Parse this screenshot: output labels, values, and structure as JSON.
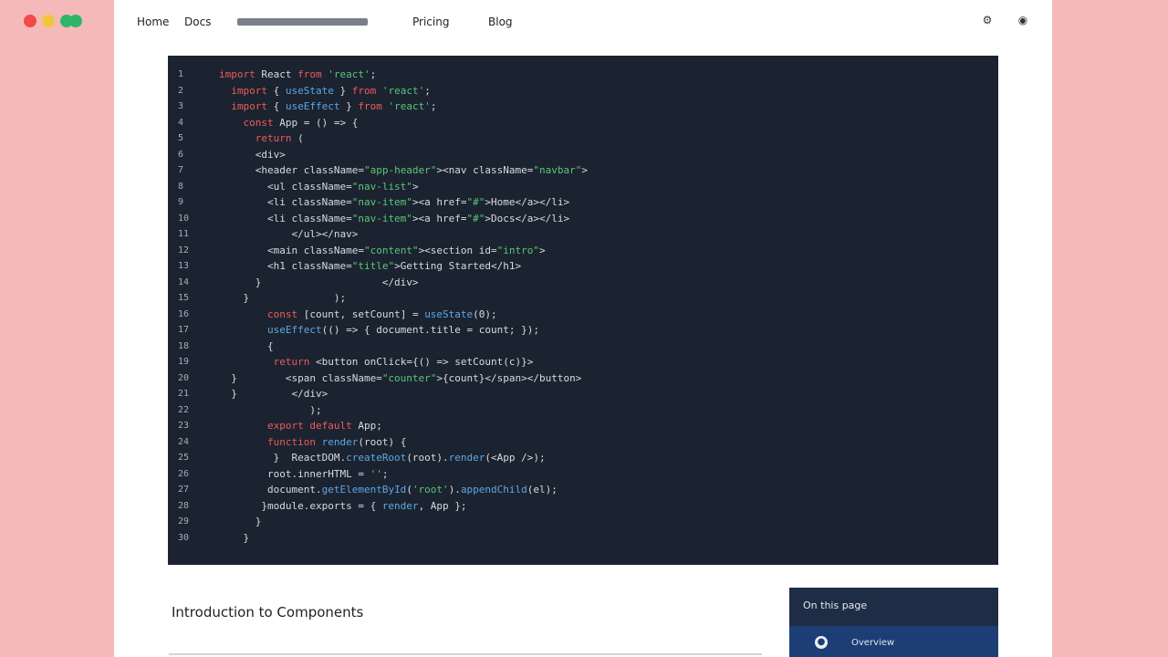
{
  "window": {
    "controls": [
      "close",
      "minimize",
      "maximize"
    ]
  },
  "topnav": {
    "items": [
      {
        "label": "Home"
      },
      {
        "label": "Docs"
      },
      {
        "label": "Pricing"
      },
      {
        "label": "Blog"
      }
    ],
    "icons": [
      "settings-icon",
      "github-icon"
    ]
  },
  "code": {
    "lines": [
      {
        "num": "1",
        "text": "import React from 'react';"
      },
      {
        "num": "2",
        "text": "  import { useState } from 'react';"
      },
      {
        "num": "3",
        "text": "  import { useEffect } from 'react';"
      },
      {
        "num": "4",
        "text": "    const App = () => {"
      },
      {
        "num": "5",
        "text": "      return ("
      },
      {
        "num": "6",
        "text": "      <div>"
      },
      {
        "num": "7",
        "text": "      <header className=\"app-header\"><nav className=\"navbar\">"
      },
      {
        "num": "8",
        "text": "        <ul className=\"nav-list\">"
      },
      {
        "num": "9",
        "text": "        <li className=\"nav-item\"><a href=\"#\">Home</a></li>"
      },
      {
        "num": "10",
        "text": "        <li className=\"nav-item\"><a href=\"#\">Docs</a></li>"
      },
      {
        "num": "11",
        "text": "            </ul></nav>"
      },
      {
        "num": "12",
        "text": "        <main className=\"content\"><section id=\"intro\">"
      },
      {
        "num": "13",
        "text": "        <h1 className=\"title\">Getting Started</h1>"
      },
      {
        "num": "14",
        "text": "      }                    </div>"
      },
      {
        "num": "15",
        "text": "    }              );"
      },
      {
        "num": "16",
        "text": "        const [count, setCount] = useState(0);"
      },
      {
        "num": "17",
        "text": "        useEffect(() => { document.title = count; });"
      },
      {
        "num": "18",
        "text": "        {"
      },
      {
        "num": "19",
        "text": "         return <button onClick={() => setCount(c)}>"
      },
      {
        "num": "20",
        "text": "  }        <span className=\"counter\">{count}</span></button>"
      },
      {
        "num": "21",
        "text": "  }         </div>"
      },
      {
        "num": "22",
        "text": "               );"
      },
      {
        "num": "23",
        "text": "        export default App;"
      },
      {
        "num": "24",
        "text": "        function render(root) {"
      },
      {
        "num": "25",
        "text": "         }  ReactDOM.createRoot(root).render(<App />);"
      },
      {
        "num": "26",
        "text": "        root.innerHTML = '';"
      },
      {
        "num": "27",
        "text": "        document.getElementById('root').appendChild(el);"
      },
      {
        "num": "28",
        "text": "       }module.exports = { render, App };"
      },
      {
        "num": "29",
        "text": "      }"
      },
      {
        "num": "30",
        "text": "    }"
      }
    ]
  },
  "main": {
    "heading": "Introduction to Components"
  },
  "side_panel": {
    "title": "On this page",
    "row_label": "Overview"
  }
}
